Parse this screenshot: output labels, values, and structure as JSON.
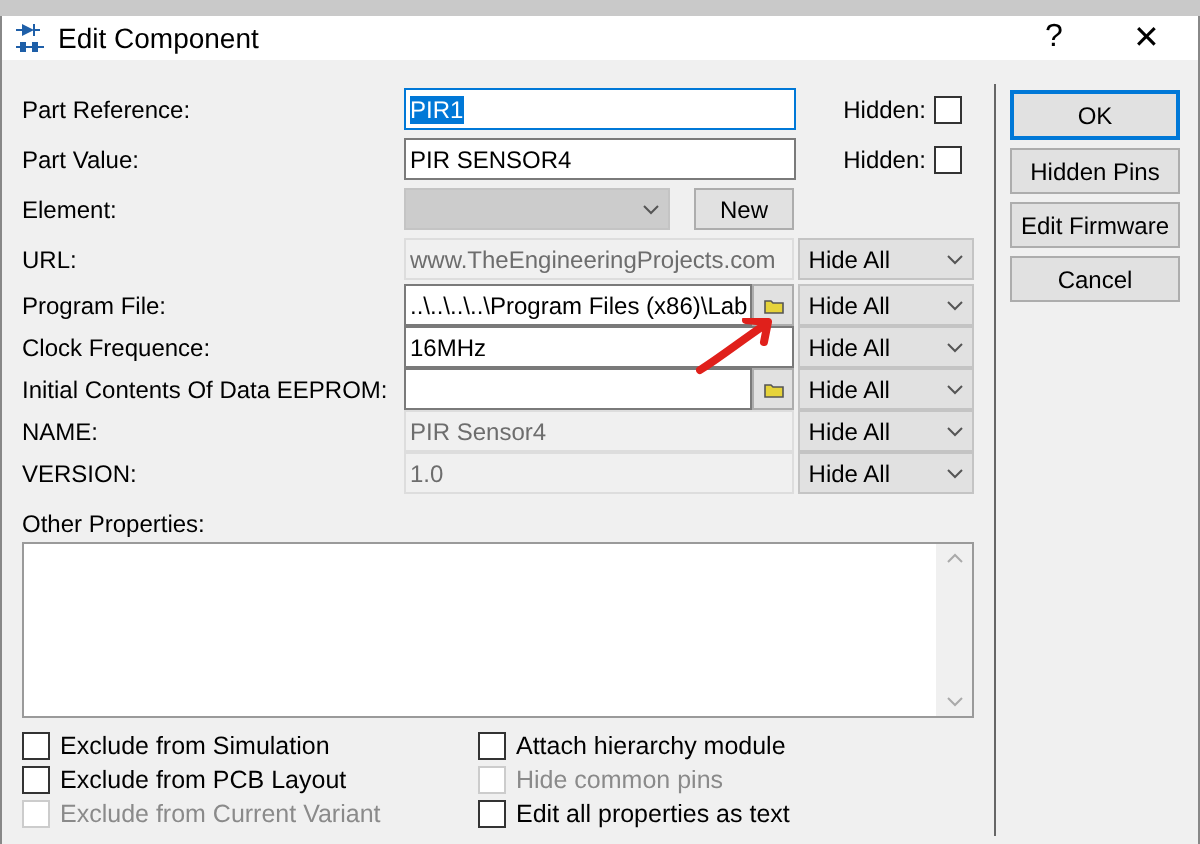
{
  "window": {
    "title": "Edit Component",
    "help": "?",
    "close": "✕"
  },
  "fields": [
    {
      "kind": "text",
      "label": "Part Reference:",
      "value": "PIR1",
      "text_selected": true,
      "hidden_label": "Hidden:",
      "hidden_checked": false
    },
    {
      "kind": "text",
      "label": "Part Value:",
      "value": "PIR SENSOR4",
      "text_selected": false,
      "hidden_label": "Hidden:",
      "hidden_checked": false
    },
    {
      "kind": "combo",
      "label": "Element:",
      "disabled": true,
      "button": "New"
    },
    {
      "kind": "readonly",
      "label": "URL:",
      "value": "www.TheEngineeringProjects.com",
      "visibility": "Hide All"
    },
    {
      "kind": "browse",
      "label": "Program File:",
      "value": "..\\..\\..\\..\\Program Files (x86)\\Lab",
      "visibility": "Hide All"
    },
    {
      "kind": "text",
      "label": "Clock Frequence:",
      "value": "16MHz",
      "text_selected": false,
      "visibility": "Hide All"
    },
    {
      "kind": "browse",
      "label": "Initial Contents Of Data EEPROM:",
      "visibility": "Hide All"
    },
    {
      "kind": "readonly",
      "label": "NAME:",
      "value": "PIR Sensor4",
      "visibility": "Hide All"
    },
    {
      "kind": "readonly",
      "label": "VERSION:",
      "value": "1.0",
      "visibility": "Hide All"
    }
  ],
  "other_properties": {
    "label": "Other Properties:"
  },
  "options_left": [
    {
      "label": "Exclude from Simulation",
      "checked": false,
      "disabled": false
    },
    {
      "label": "Exclude from PCB Layout",
      "checked": false,
      "disabled": false
    },
    {
      "label": "Exclude from Current Variant",
      "checked": false,
      "disabled": true
    }
  ],
  "options_right": [
    {
      "label": "Attach hierarchy module",
      "checked": false,
      "disabled": false
    },
    {
      "label": "Hide common pins",
      "checked": false,
      "disabled": true
    },
    {
      "label": "Edit all properties as text",
      "checked": false,
      "disabled": false
    }
  ],
  "buttons": [
    {
      "label": "OK",
      "default": true
    },
    {
      "label": "Hidden Pins",
      "default": false
    },
    {
      "label": "Edit Firmware",
      "default": false
    },
    {
      "label": "Cancel",
      "default": false
    }
  ]
}
